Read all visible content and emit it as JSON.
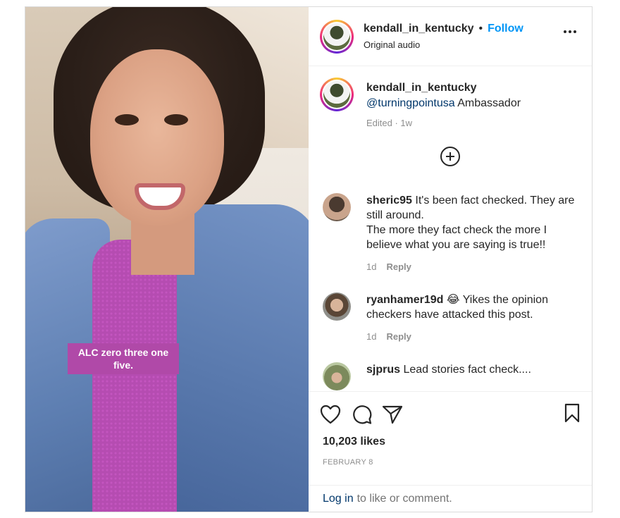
{
  "post": {
    "overlay_text": "ALC zero three one five.",
    "header": {
      "username": "kendall_in_kentucky",
      "separator": "•",
      "follow_label": "Follow",
      "subtitle": "Original audio"
    },
    "caption": {
      "username": "kendall_in_kentucky",
      "mention": "@turningpointusa",
      "text": "Ambassador",
      "meta": "Edited · 1w"
    },
    "comments": [
      {
        "username": "sheric95",
        "text": "It's been fact checked. They are still around.",
        "text2": "The more they fact check the more I believe what you are saying is true!!",
        "time": "1d",
        "reply_label": "Reply"
      },
      {
        "username": "ryanhamer19d",
        "emoji": "😂",
        "text": "Yikes the opinion checkers have attacked this post.",
        "time": "1d",
        "reply_label": "Reply"
      },
      {
        "username": "sjprus",
        "text": "Lead stories fact check...."
      }
    ],
    "likes": "10,203 likes",
    "date": "FEBRUARY 8",
    "login": {
      "link": "Log in",
      "text": "to like or comment."
    }
  },
  "icons": [
    "heart-icon",
    "comment-icon",
    "share-icon",
    "bookmark-icon",
    "more-icon",
    "add-icon"
  ],
  "colors": {
    "accent": "#0095f6",
    "mention": "#00376b",
    "muted": "#8e8e8e",
    "overlay": "#b049a8"
  }
}
